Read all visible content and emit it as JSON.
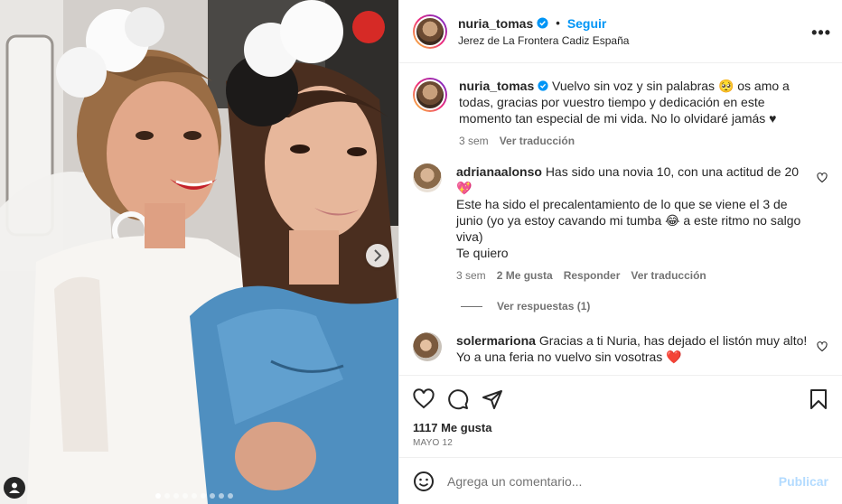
{
  "header": {
    "username": "nuria_tomas",
    "separator": "•",
    "follow_label": "Seguir",
    "location": "Jerez de La Frontera Cadiz España",
    "more_label": "•••"
  },
  "caption": {
    "username": "nuria_tomas",
    "text": "Vuelvo sin voz y sin palabras 🥺 os amo a todas, gracias por vuestro tiempo y dedicación en este momento tan especial de mi vida. No lo olvidaré jamás ♥",
    "time": "3 sem",
    "translate_label": "Ver traducción"
  },
  "comments": [
    {
      "username": "adrianaalonso",
      "text_lines": [
        "Has sido una novia 10, con una actitud de 20 💖",
        "Este ha sido el precalentamiento de lo que se viene el 3 de junio (yo ya estoy cavando mi tumba 😂 a este ritmo no salgo viva)",
        "Te quiero"
      ],
      "time": "3 sem",
      "likes_label": "2 Me gusta",
      "reply_label": "Responder",
      "translate_label": "Ver traducción",
      "view_replies_label": "Ver respuestas (1)"
    },
    {
      "username": "solermariona",
      "text_lines": [
        "Gracias a ti Nuria, has dejado el listón muy alto! Yo a una feria no vuelvo sin vosotras ❤️"
      ]
    }
  ],
  "actions": {
    "likes_count": "1117 Me gusta",
    "date": "MAYO 12"
  },
  "add_comment": {
    "placeholder": "Agrega un comentario...",
    "publish_label": "Publicar"
  },
  "carousel": {
    "dot_count": 9,
    "active_dot": 0
  },
  "colors": {
    "link_blue": "#0095f6",
    "publish_disabled": "#b3dbff",
    "secondary_text": "#737373",
    "heart_red": "#ed4956"
  },
  "icons": [
    "verified-badge-icon",
    "more-options-icon",
    "heart-icon",
    "comment-icon",
    "share-icon",
    "bookmark-icon",
    "emoji-icon",
    "chevron-right-icon",
    "user-tag-icon"
  ]
}
